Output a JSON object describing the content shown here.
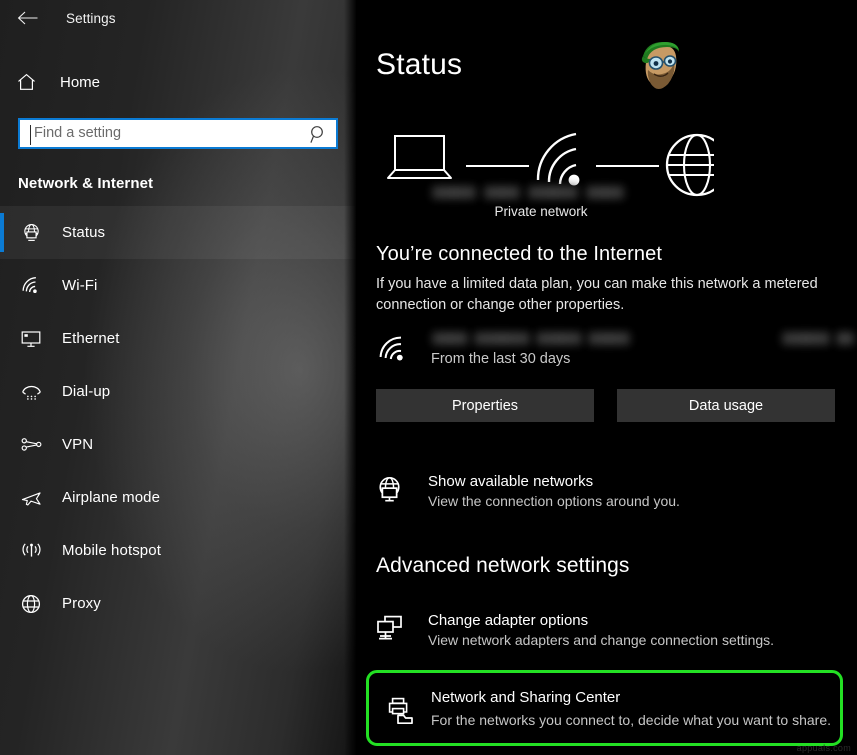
{
  "window": {
    "title": "Settings",
    "back_icon": "back-arrow-icon"
  },
  "sidebar": {
    "home": {
      "label": "Home",
      "icon": "home-icon"
    },
    "search": {
      "placeholder": "Find a setting",
      "value": "",
      "icon": "search-icon"
    },
    "category_heading": "Network & Internet",
    "items": [
      {
        "label": "Status",
        "icon": "globe-monitor-icon",
        "selected": true
      },
      {
        "label": "Wi-Fi",
        "icon": "wifi-icon",
        "selected": false
      },
      {
        "label": "Ethernet",
        "icon": "ethernet-icon",
        "selected": false
      },
      {
        "label": "Dial-up",
        "icon": "dialup-phone-icon",
        "selected": false
      },
      {
        "label": "VPN",
        "icon": "vpn-icon",
        "selected": false
      },
      {
        "label": "Airplane mode",
        "icon": "airplane-icon",
        "selected": false
      },
      {
        "label": "Mobile hotspot",
        "icon": "hotspot-icon",
        "selected": false
      },
      {
        "label": "Proxy",
        "icon": "globe-icon",
        "selected": false
      }
    ],
    "selected_accent_color": "#0b7bd4"
  },
  "main": {
    "page_title": "Status",
    "diagram": {
      "device_icon": "laptop-icon",
      "link_icon": "wifi-icon",
      "internet_icon": "globe-icon",
      "network_name_redacted": true,
      "network_type_label": "Private network"
    },
    "connection": {
      "headline": "You’re connected to the Internet",
      "description": "If you have a limited data plan, you can make this network a metered connection or change other properties."
    },
    "data_usage": {
      "icon": "wifi-icon",
      "network_name_redacted": true,
      "amount_redacted": true,
      "period_label": "From the last 30 days"
    },
    "buttons": [
      {
        "label": "Properties"
      },
      {
        "label": "Data usage"
      }
    ],
    "show_networks": {
      "icon": "globe-monitor-icon",
      "title": "Show available networks",
      "description": "View the connection options around you."
    },
    "advanced_heading": "Advanced network settings",
    "advanced_items": [
      {
        "icon": "two-monitors-icon",
        "title": "Change adapter options",
        "description": "View network adapters and change connection settings.",
        "highlighted": false
      },
      {
        "icon": "printer-folder-share-icon",
        "title": "Network and Sharing Center",
        "description": "For the networks you connect to, decide what you want to share.",
        "highlighted": true
      }
    ],
    "highlight_color": "#23e023"
  },
  "watermark": {
    "mascot_icon": "cartoon-mascot-icon",
    "footer_text": "appuals.com"
  }
}
